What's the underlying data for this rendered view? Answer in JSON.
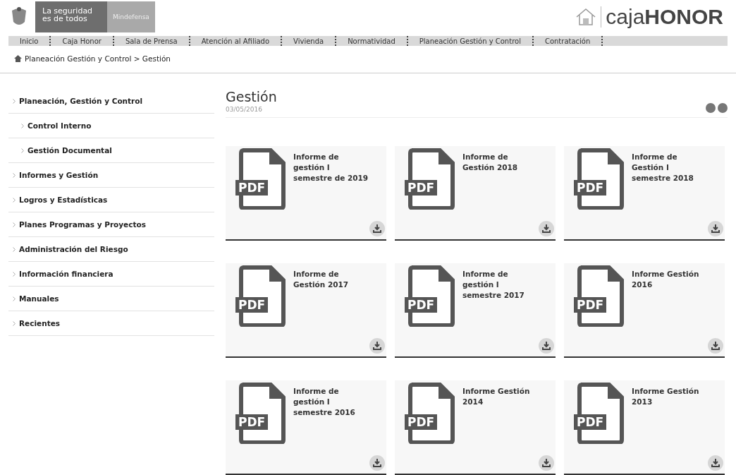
{
  "header": {
    "slogan": "La seguridad es de todos",
    "ministry": "Mindefensa",
    "logo": {
      "brand_light": "caja",
      "brand_bold": "HONOR"
    }
  },
  "nav": [
    "Inicio",
    "Caja Honor",
    "Sala de Prensa",
    "Atención al Afiliado",
    "Vivienda",
    "Normatividad",
    "Planeación Gestión y Control",
    "Contratación"
  ],
  "breadcrumb": "Planeación Gestión y Control > Gestión",
  "sidebar": {
    "items": [
      {
        "label": "Planeación, Gestión y Control",
        "children": [
          {
            "label": "Control Interno"
          },
          {
            "label": "Gestión Documental"
          }
        ]
      },
      {
        "label": "Informes y Gestión"
      },
      {
        "label": "Logros y Estadísticas"
      },
      {
        "label": "Planes Programas y Proyectos"
      },
      {
        "label": "Administración del Riesgo"
      },
      {
        "label": "Información financiera"
      },
      {
        "label": "Manuales"
      },
      {
        "label": "Recientes"
      }
    ]
  },
  "page": {
    "title": "Gestión",
    "date": "03/05/2016"
  },
  "documents": [
    {
      "title": "Informe de gestión I semestre de 2019",
      "badge": "PDF"
    },
    {
      "title": "Informe de Gestión 2018",
      "badge": "PDF"
    },
    {
      "title": "Informe de Gestión I semestre 2018",
      "badge": "PDF"
    },
    {
      "title": "Informe de Gestión 2017",
      "badge": "PDF"
    },
    {
      "title": "Informe de gestión I semestre 2017",
      "badge": "PDF"
    },
    {
      "title": "Informe Gestión 2016",
      "badge": "PDF"
    },
    {
      "title": "Informe de gestión I semestre 2016",
      "badge": "PDF"
    },
    {
      "title": "Informe Gestión 2014",
      "badge": "PDF"
    },
    {
      "title": "Informe Gestión 2013",
      "badge": "PDF"
    }
  ]
}
